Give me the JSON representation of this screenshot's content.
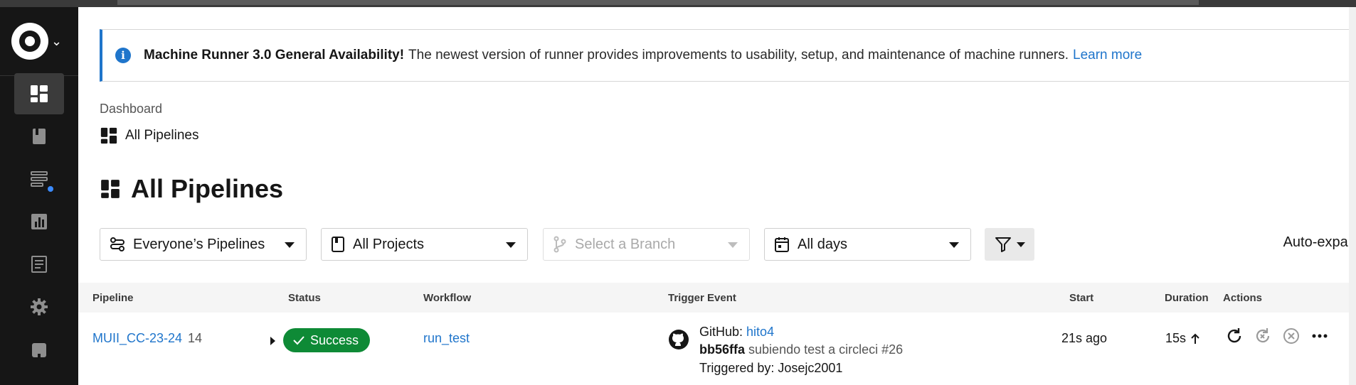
{
  "banner": {
    "title": "Machine Runner 3.0 General Availability!",
    "message": "The newest version of runner provides improvements to usability, setup, and maintenance of machine runners.",
    "link": "Learn more",
    "close": "✕"
  },
  "breadcrumb": {
    "parent": "Dashboard",
    "current": "All Pipelines"
  },
  "page": {
    "title": "All Pipelines"
  },
  "filters": {
    "pipelines": "Everyone’s Pipelines",
    "projects": "All Projects",
    "branch_placeholder": "Select a Branch",
    "days": "All days",
    "auto_expand": "Auto-expand",
    "auto_expand_on": false
  },
  "table": {
    "headers": {
      "pipeline": "Pipeline",
      "status": "Status",
      "workflow": "Workflow",
      "trigger": "Trigger Event",
      "start": "Start",
      "duration": "Duration",
      "actions": "Actions"
    },
    "rows": [
      {
        "pipeline": "MUII_CC-23-24",
        "number": "14",
        "status": "Success",
        "workflow": "run_test",
        "trigger_source": "GitHub:",
        "trigger_user": "hito4",
        "commit_sha": "bb56ffa",
        "commit_msg": "subiendo test a circleci #26",
        "triggered_by": "Triggered by: Josejc2001",
        "start": "21s ago",
        "duration": "15s"
      }
    ]
  },
  "colors": {
    "sidebar_bg": "#161616",
    "accent_blue": "#1f75cb",
    "success_green": "#0e8a36",
    "notification_dot": "#3b8bff"
  },
  "icons": {
    "sidebar": [
      "dashboard-icon",
      "projects-book-icon",
      "runners-icon",
      "insights-chart-icon",
      "org-settings-doc-icon",
      "settings-gear-icon",
      "plan-icon"
    ],
    "row_actions": [
      "rerun-icon",
      "rerun-failed-icon",
      "cancel-icon",
      "more-icon"
    ]
  }
}
